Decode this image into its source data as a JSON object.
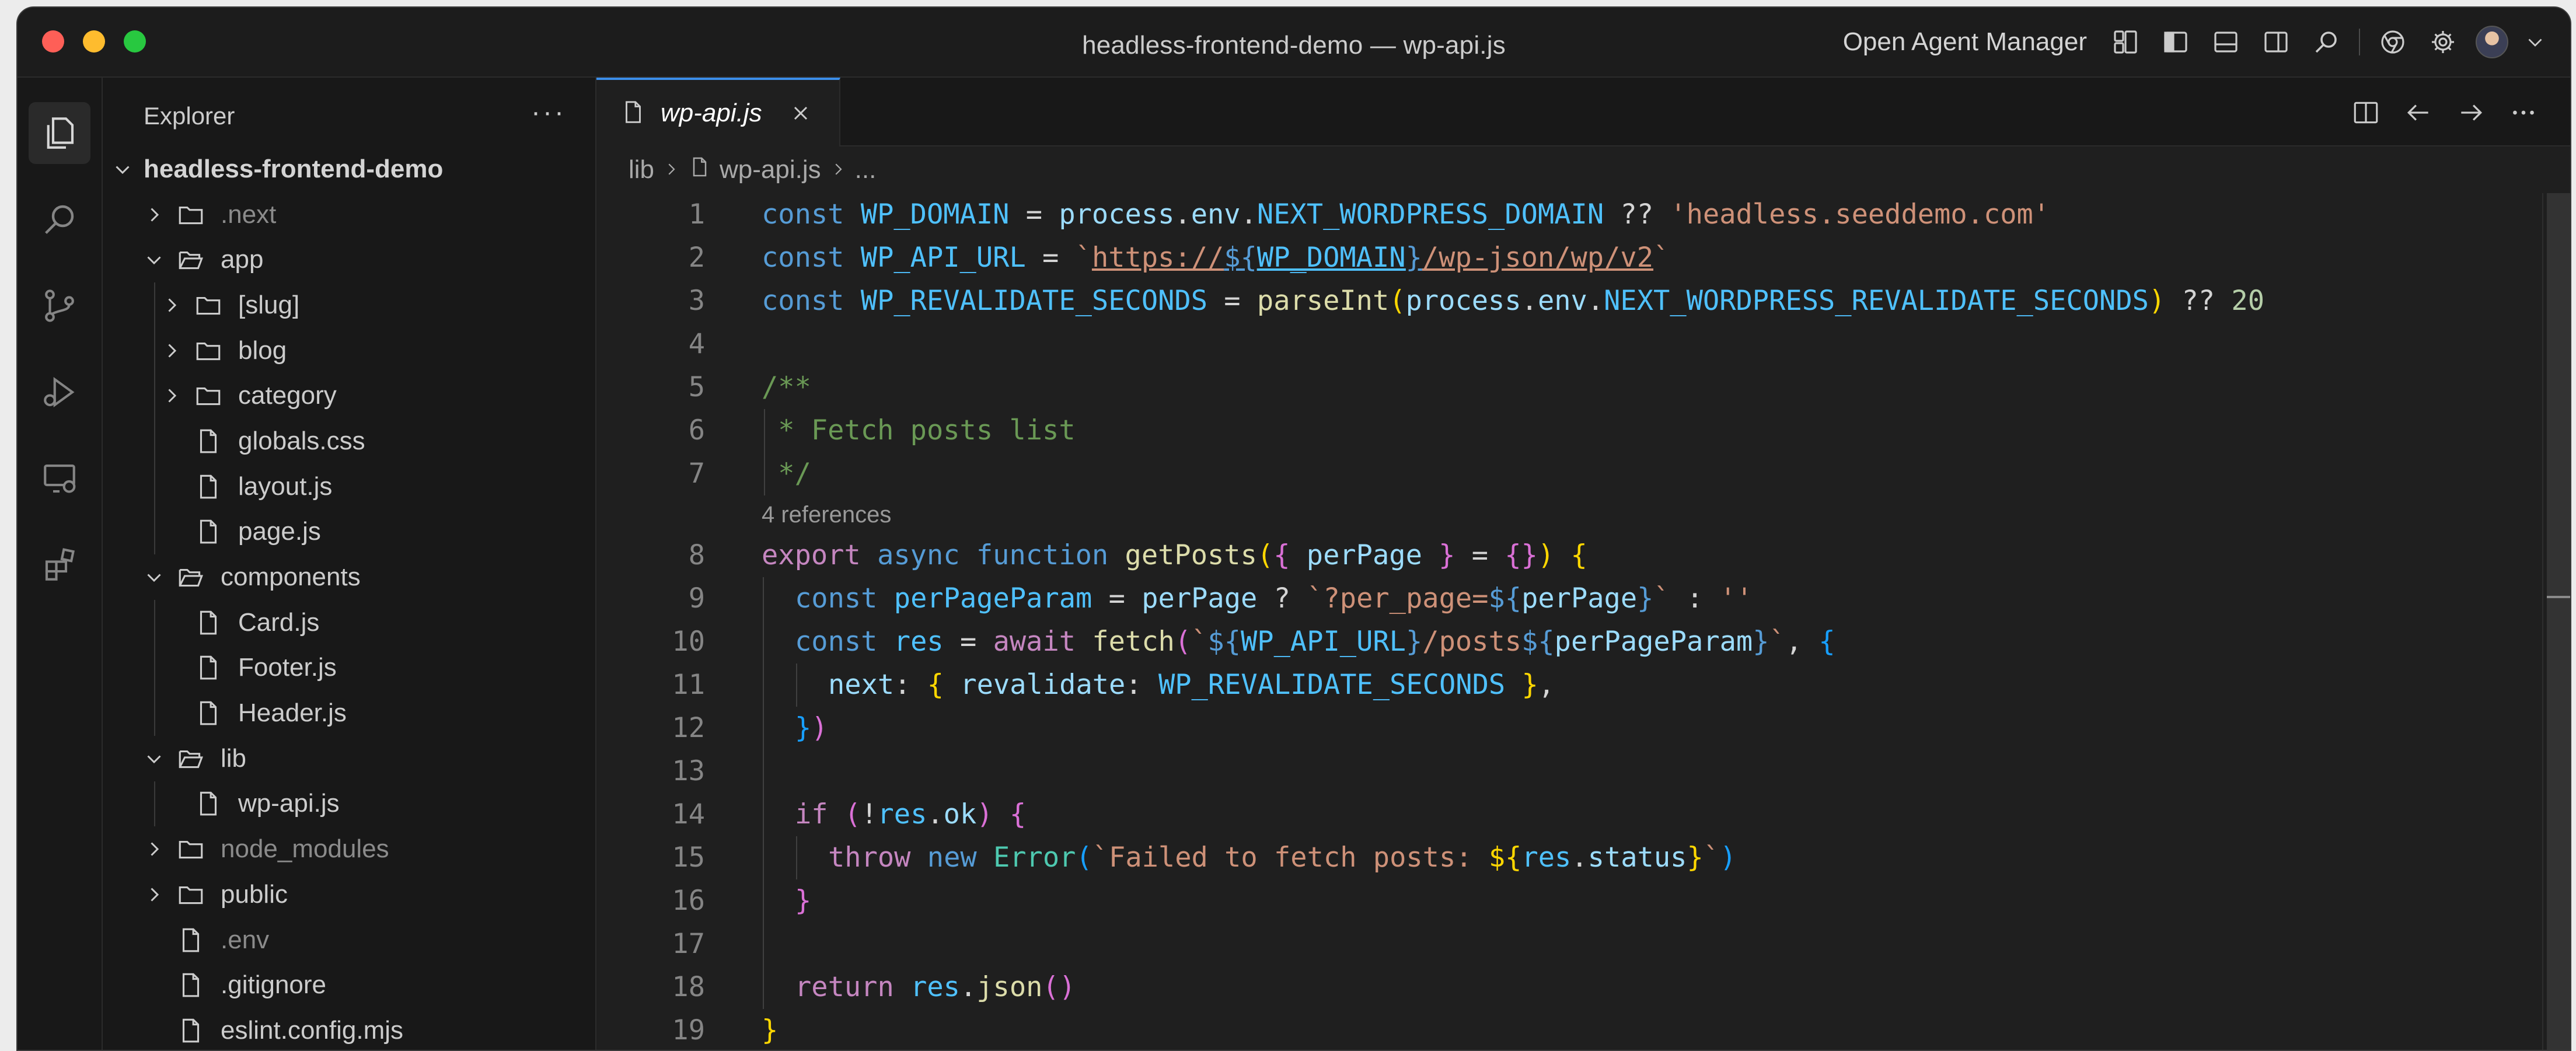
{
  "window": {
    "title": "headless-frontend-demo — wp-api.js"
  },
  "titlebar": {
    "agent_manager_label": "Open Agent Manager"
  },
  "sidebar": {
    "title": "Explorer",
    "more": "···",
    "tree": [
      {
        "label": "headless-frontend-demo",
        "depth": 0,
        "kind": "root",
        "expanded": true
      },
      {
        "label": ".next",
        "depth": 1,
        "kind": "folder",
        "expanded": false,
        "dim": true
      },
      {
        "label": "app",
        "depth": 1,
        "kind": "folder",
        "expanded": true
      },
      {
        "label": "[slug]",
        "depth": 2,
        "kind": "folder",
        "expanded": false
      },
      {
        "label": "blog",
        "depth": 2,
        "kind": "folder",
        "expanded": false
      },
      {
        "label": "category",
        "depth": 2,
        "kind": "folder",
        "expanded": false
      },
      {
        "label": "globals.css",
        "depth": 2,
        "kind": "file"
      },
      {
        "label": "layout.js",
        "depth": 2,
        "kind": "file"
      },
      {
        "label": "page.js",
        "depth": 2,
        "kind": "file"
      },
      {
        "label": "components",
        "depth": 1,
        "kind": "folder",
        "expanded": true
      },
      {
        "label": "Card.js",
        "depth": 2,
        "kind": "file"
      },
      {
        "label": "Footer.js",
        "depth": 2,
        "kind": "file"
      },
      {
        "label": "Header.js",
        "depth": 2,
        "kind": "file"
      },
      {
        "label": "lib",
        "depth": 1,
        "kind": "folder",
        "expanded": true
      },
      {
        "label": "wp-api.js",
        "depth": 2,
        "kind": "file"
      },
      {
        "label": "node_modules",
        "depth": 1,
        "kind": "folder",
        "expanded": false,
        "dim": true
      },
      {
        "label": "public",
        "depth": 1,
        "kind": "folder",
        "expanded": false
      },
      {
        "label": ".env",
        "depth": 1,
        "kind": "file",
        "dim": true
      },
      {
        "label": ".gitignore",
        "depth": 1,
        "kind": "file"
      },
      {
        "label": "eslint.config.mjs",
        "depth": 1,
        "kind": "file"
      }
    ]
  },
  "editor": {
    "tab_label": "wp-api.js",
    "breadcrumb": {
      "folder": "lib",
      "file": "wp-api.js",
      "more": "..."
    },
    "codelens": "4 references",
    "lines": [
      {
        "n": "1",
        "indent": 0,
        "tokens": [
          [
            "const ",
            "kw"
          ],
          [
            "WP_DOMAIN",
            "cn"
          ],
          [
            " = ",
            "op"
          ],
          [
            "process",
            "vr"
          ],
          [
            ".",
            "op"
          ],
          [
            "env",
            "vr"
          ],
          [
            ".",
            "op"
          ],
          [
            "NEXT_WORDPRESS_DOMAIN",
            "cn"
          ],
          [
            " ?? ",
            "op"
          ],
          [
            "'headless.seeddemo.com'",
            "st"
          ]
        ]
      },
      {
        "n": "2",
        "indent": 0,
        "tokens": [
          [
            "const ",
            "kw"
          ],
          [
            "WP_API_URL",
            "cn"
          ],
          [
            " = ",
            "op"
          ],
          [
            "`",
            "st"
          ],
          [
            "https://",
            "st ul"
          ],
          [
            "${",
            "tp ul"
          ],
          [
            "WP_DOMAIN",
            "cn ul"
          ],
          [
            "}",
            "tp ul"
          ],
          [
            "/wp-json/wp/v2",
            "st ul"
          ],
          [
            "`",
            "st"
          ]
        ]
      },
      {
        "n": "3",
        "indent": 0,
        "tokens": [
          [
            "const ",
            "kw"
          ],
          [
            "WP_REVALIDATE_SECONDS",
            "cn"
          ],
          [
            " = ",
            "op"
          ],
          [
            "parseInt",
            "fn"
          ],
          [
            "(",
            "p1"
          ],
          [
            "process",
            "vr"
          ],
          [
            ".",
            "op"
          ],
          [
            "env",
            "vr"
          ],
          [
            ".",
            "op"
          ],
          [
            "NEXT_WORDPRESS_REVALIDATE_SECONDS",
            "cn"
          ],
          [
            ")",
            "p1"
          ],
          [
            " ?? ",
            "op"
          ],
          [
            "20",
            "nm"
          ]
        ]
      },
      {
        "n": "4",
        "indent": 0,
        "tokens": []
      },
      {
        "n": "5",
        "indent": 0,
        "tokens": [
          [
            "/**",
            "cm"
          ]
        ]
      },
      {
        "n": "6",
        "indent": 0,
        "tokens": [
          [
            " * Fetch posts list",
            "cm"
          ]
        ]
      },
      {
        "n": "7",
        "indent": 0,
        "tokens": [
          [
            " */",
            "cm"
          ]
        ]
      },
      {
        "n": "8",
        "indent": 0,
        "codelens": true,
        "tokens": [
          [
            "export ",
            "kc"
          ],
          [
            "async ",
            "kw"
          ],
          [
            "function ",
            "kw"
          ],
          [
            "getPosts",
            "fn"
          ],
          [
            "(",
            "p1"
          ],
          [
            "{ ",
            "p2"
          ],
          [
            "perPage",
            "vr"
          ],
          [
            " } ",
            "p2"
          ],
          [
            "= ",
            "op"
          ],
          [
            "{}",
            "p2"
          ],
          [
            ")",
            "p1"
          ],
          [
            " {",
            "p1"
          ]
        ]
      },
      {
        "n": "9",
        "indent": 1,
        "tokens": [
          [
            "const ",
            "kw"
          ],
          [
            "perPageParam",
            "cn"
          ],
          [
            " = ",
            "op"
          ],
          [
            "perPage",
            "vr"
          ],
          [
            " ? ",
            "op"
          ],
          [
            "`?per_page=",
            "st"
          ],
          [
            "${",
            "tp"
          ],
          [
            "perPage",
            "vr"
          ],
          [
            "}",
            "tp"
          ],
          [
            "`",
            "st"
          ],
          [
            " : ",
            "op"
          ],
          [
            "''",
            "st"
          ]
        ]
      },
      {
        "n": "10",
        "indent": 1,
        "tokens": [
          [
            "const ",
            "kw"
          ],
          [
            "res",
            "cn"
          ],
          [
            " = ",
            "op"
          ],
          [
            "await ",
            "kc"
          ],
          [
            "fetch",
            "fn"
          ],
          [
            "(",
            "p2"
          ],
          [
            "`",
            "st"
          ],
          [
            "${",
            "tp"
          ],
          [
            "WP_API_URL",
            "cn"
          ],
          [
            "}",
            "tp"
          ],
          [
            "/posts",
            "st"
          ],
          [
            "${",
            "tp"
          ],
          [
            "perPageParam",
            "vr"
          ],
          [
            "}",
            "tp"
          ],
          [
            "`",
            "st"
          ],
          [
            ", ",
            "op"
          ],
          [
            "{",
            "p3"
          ]
        ]
      },
      {
        "n": "11",
        "indent": 2,
        "tokens": [
          [
            "next",
            "vr"
          ],
          [
            ": ",
            "op"
          ],
          [
            "{ ",
            "p1"
          ],
          [
            "revalidate",
            "vr"
          ],
          [
            ": ",
            "op"
          ],
          [
            "WP_REVALIDATE_SECONDS",
            "cn"
          ],
          [
            " }",
            "p1"
          ],
          [
            ",",
            "op"
          ]
        ]
      },
      {
        "n": "12",
        "indent": 1,
        "tokens": [
          [
            "}",
            "p3"
          ],
          [
            ")",
            "p2"
          ]
        ]
      },
      {
        "n": "13",
        "indent": 1,
        "tokens": []
      },
      {
        "n": "14",
        "indent": 1,
        "tokens": [
          [
            "if ",
            "kc"
          ],
          [
            "(",
            "p2"
          ],
          [
            "!",
            "op"
          ],
          [
            "res",
            "cn"
          ],
          [
            ".",
            "op"
          ],
          [
            "ok",
            "vr"
          ],
          [
            ")",
            "p2"
          ],
          [
            " {",
            "p2"
          ]
        ]
      },
      {
        "n": "15",
        "indent": 2,
        "tokens": [
          [
            "throw ",
            "kc"
          ],
          [
            "new ",
            "kw"
          ],
          [
            "Error",
            "cl"
          ],
          [
            "(",
            "p3"
          ],
          [
            "`Failed to fetch posts: ",
            "st"
          ],
          [
            "${",
            "p1"
          ],
          [
            "res",
            "cn"
          ],
          [
            ".",
            "op"
          ],
          [
            "status",
            "vr"
          ],
          [
            "}",
            "p1"
          ],
          [
            "`",
            "st"
          ],
          [
            ")",
            "p3"
          ]
        ]
      },
      {
        "n": "16",
        "indent": 1,
        "tokens": [
          [
            "}",
            "p2"
          ]
        ]
      },
      {
        "n": "17",
        "indent": 1,
        "tokens": []
      },
      {
        "n": "18",
        "indent": 1,
        "tokens": [
          [
            "return ",
            "kc"
          ],
          [
            "res",
            "cn"
          ],
          [
            ".",
            "op"
          ],
          [
            "json",
            "fn"
          ],
          [
            "()",
            "p2"
          ]
        ]
      },
      {
        "n": "19",
        "indent": 0,
        "tokens": [
          [
            "}",
            "p1"
          ]
        ]
      }
    ]
  },
  "colors": {
    "accent": "#3b8eea",
    "editor_bg": "#1f1f1f",
    "sidebar_bg": "#181818",
    "traffic_red": "#fe5f57",
    "traffic_yellow": "#febc2e",
    "traffic_green": "#28c840"
  },
  "icons": {
    "activity": [
      "explorer-icon",
      "search-icon",
      "source-control-icon",
      "run-debug-icon",
      "remote-explorer-icon",
      "extensions-icon"
    ],
    "titlebar": [
      "layout-icon",
      "toggle-primary-sidebar-icon",
      "toggle-panel-icon",
      "toggle-secondary-sidebar-icon",
      "search-icon",
      "chrome-icon",
      "gear-icon",
      "avatar"
    ]
  }
}
